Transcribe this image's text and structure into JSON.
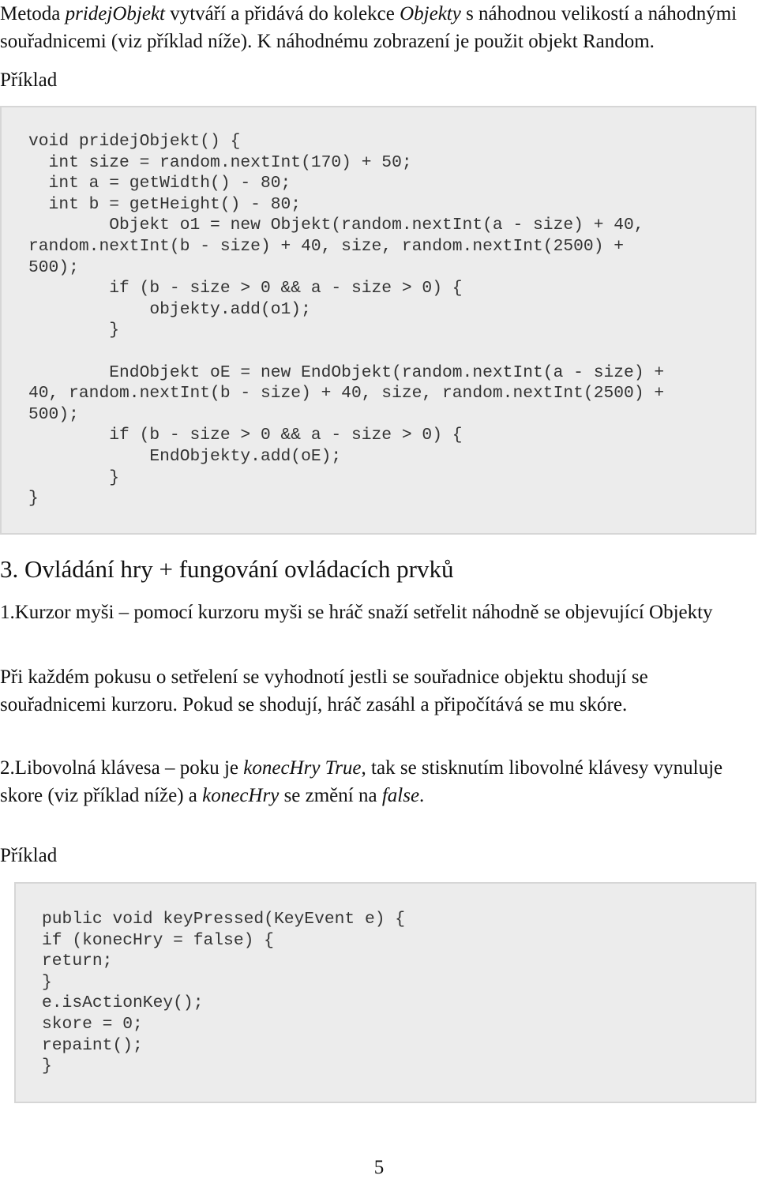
{
  "intro": {
    "parts": [
      {
        "text": "Metoda ",
        "italic": false
      },
      {
        "text": "pridejObjekt",
        "italic": true
      },
      {
        "text": " vytváří a přidává do kolekce ",
        "italic": false
      },
      {
        "text": "Objekty",
        "italic": true
      },
      {
        "text": " s náhodnou velikostí a náhodnými souřadnicemi (viz příklad níže). K náhodnému zobrazení je použit objekt Random.",
        "italic": false
      }
    ]
  },
  "example_label_1": "Příklad",
  "code_block_1": {
    "lines": [
      "void pridejObjekt() {",
      "  int size = random.nextInt(170) + 50;",
      "  int a = getWidth() - 80;",
      "  int b = getHeight() - 80;",
      "        Objekt o1 = new Objekt(random.nextInt(a - size) + 40,",
      "random.nextInt(b - size) + 40, size, random.nextInt(2500) +",
      "500);",
      "        if (b - size > 0 && a - size > 0) {",
      "            objekty.add(o1);",
      "        }",
      "",
      "        EndObjekt oE = new EndObjekt(random.nextInt(a - size) +",
      "40, random.nextInt(b - size) + 40, size, random.nextInt(2500) +",
      "500);",
      "        if (b - size > 0 && a - size > 0) {",
      "            EndObjekty.add(oE);",
      "        }",
      "}"
    ]
  },
  "section_heading": "3. Ovládání hry + fungování ovládacích prvků",
  "item_1": {
    "text": "1.Kurzor myši – pomocí kurzoru myši se hráč snaží setřelit náhodně se objevující Objekty"
  },
  "item_1_detail": "Při každém pokusu o setřelení se vyhodnotí jestli se souřadnice objektu shodují se souřadnicemi kurzoru. Pokud se shodují, hráč zasáhl a připočítává se mu skóre.",
  "item_2": {
    "parts": [
      {
        "text": "2.Libovolná klávesa – poku je ",
        "italic": false
      },
      {
        "text": "konecHry True",
        "italic": true
      },
      {
        "text": ", tak se stisknutím libovolné klávesy vynuluje skore (viz příklad níže) a ",
        "italic": false
      },
      {
        "text": "konecHry",
        "italic": true
      },
      {
        "text": " se změní na ",
        "italic": false
      },
      {
        "text": "false",
        "italic": true
      },
      {
        "text": ".",
        "italic": false
      }
    ]
  },
  "example_label_2": "Příklad",
  "code_block_2": {
    "lines": [
      "public void keyPressed(KeyEvent e) {",
      "if (konecHry = false) {",
      "return;",
      "}",
      "e.isActionKey();",
      "skore = 0;",
      "repaint();",
      "}"
    ]
  },
  "page_number": "5",
  "colors": {
    "text": "#111111",
    "code_text": "#333333",
    "code_background": "#ececec",
    "code_border": "#d6d6d6"
  }
}
